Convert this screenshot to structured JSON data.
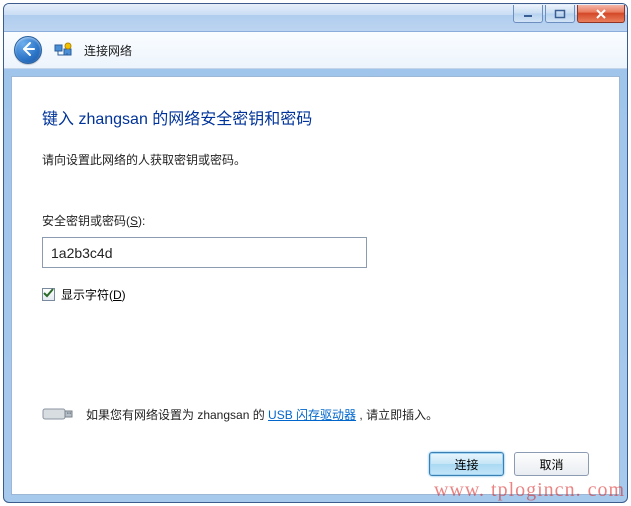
{
  "titlebar": {
    "min_label": "Minimize",
    "max_label": "Maximize",
    "close_label": "Close"
  },
  "header": {
    "back_label": "back-icon",
    "title": "连接网络"
  },
  "main": {
    "heading": "键入 zhangsan 的网络安全密钥和密码",
    "sub": "请向设置此网络的人获取密钥或密码。",
    "key_label_prefix": "安全密钥或密码(",
    "key_label_shortcut": "S",
    "key_label_suffix": "):",
    "key_value": "1a2b3c4d",
    "show_chars_prefix": "显示字符(",
    "show_chars_shortcut": "D",
    "show_chars_suffix": ")",
    "show_chars_checked": true
  },
  "usb": {
    "text_prefix": "如果您有网络设置为 zhangsan 的 ",
    "link": "USB 闪存驱动器",
    "text_suffix": " , 请立即插入。"
  },
  "buttons": {
    "connect": "连接",
    "cancel": "取消"
  },
  "watermark": "www. tplogincn. com"
}
